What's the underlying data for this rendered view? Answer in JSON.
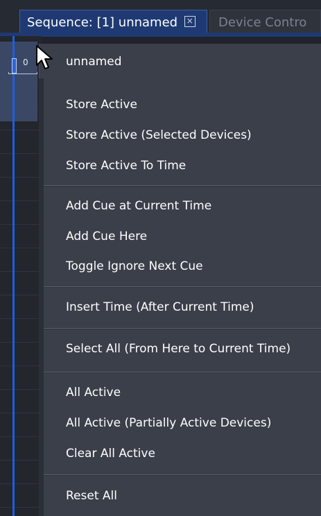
{
  "tabs": {
    "active_label": "Sequence: [1] unnamed",
    "close_glyph": "×",
    "inactive_label": "Device Contro"
  },
  "timeline": {
    "zero_label": "0"
  },
  "menu": {
    "header": "unnamed",
    "items": {
      "store_active": "Store Active",
      "store_active_selected": "Store Active (Selected Devices)",
      "store_active_to_time": "Store Active To Time",
      "add_cue_current_time": "Add Cue at Current Time",
      "add_cue_here": "Add Cue Here",
      "toggle_ignore_next_cue": "Toggle Ignore Next Cue",
      "insert_time": "Insert Time (After Current Time)",
      "select_all": "Select All (From Here to Current Time)",
      "all_active": "All Active",
      "all_active_partial": "All Active (Partially Active Devices)",
      "clear_all_active": "Clear All Active",
      "reset_all": "Reset All"
    }
  },
  "icons": {
    "cursor": "mouse-pointer-icon",
    "tab_close": "close-box-icon"
  },
  "colors": {
    "active_tab": "#1f3a73",
    "menu_bg": "#3a3f4a",
    "timeline_line": "#1d5fe0"
  }
}
